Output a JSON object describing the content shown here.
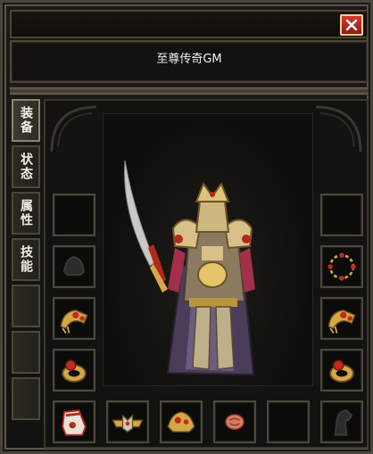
{
  "window": {
    "player_name": "至尊传奇GM"
  },
  "tabs": [
    {
      "label": "装备",
      "active": true
    },
    {
      "label": "状态",
      "active": false
    },
    {
      "label": "属性",
      "active": false
    },
    {
      "label": "技能",
      "active": false
    },
    {
      "label": "",
      "active": false
    },
    {
      "label": "",
      "active": false
    },
    {
      "label": "",
      "active": false
    }
  ],
  "equipment": {
    "left_slots": [
      "empty",
      "helmet-faded",
      "bracelet-left",
      "ring-left",
      "boots"
    ],
    "right_slots": [
      "empty",
      "necklace",
      "bracelet-right",
      "ring-right",
      "horse-faded"
    ],
    "bottom_slots": [
      "belt",
      "amulet",
      "charm",
      "gem-stone",
      "empty"
    ]
  },
  "colors": {
    "accent_red": "#c5382b",
    "frame": "#4c473e",
    "gold": "#e6c46a"
  }
}
